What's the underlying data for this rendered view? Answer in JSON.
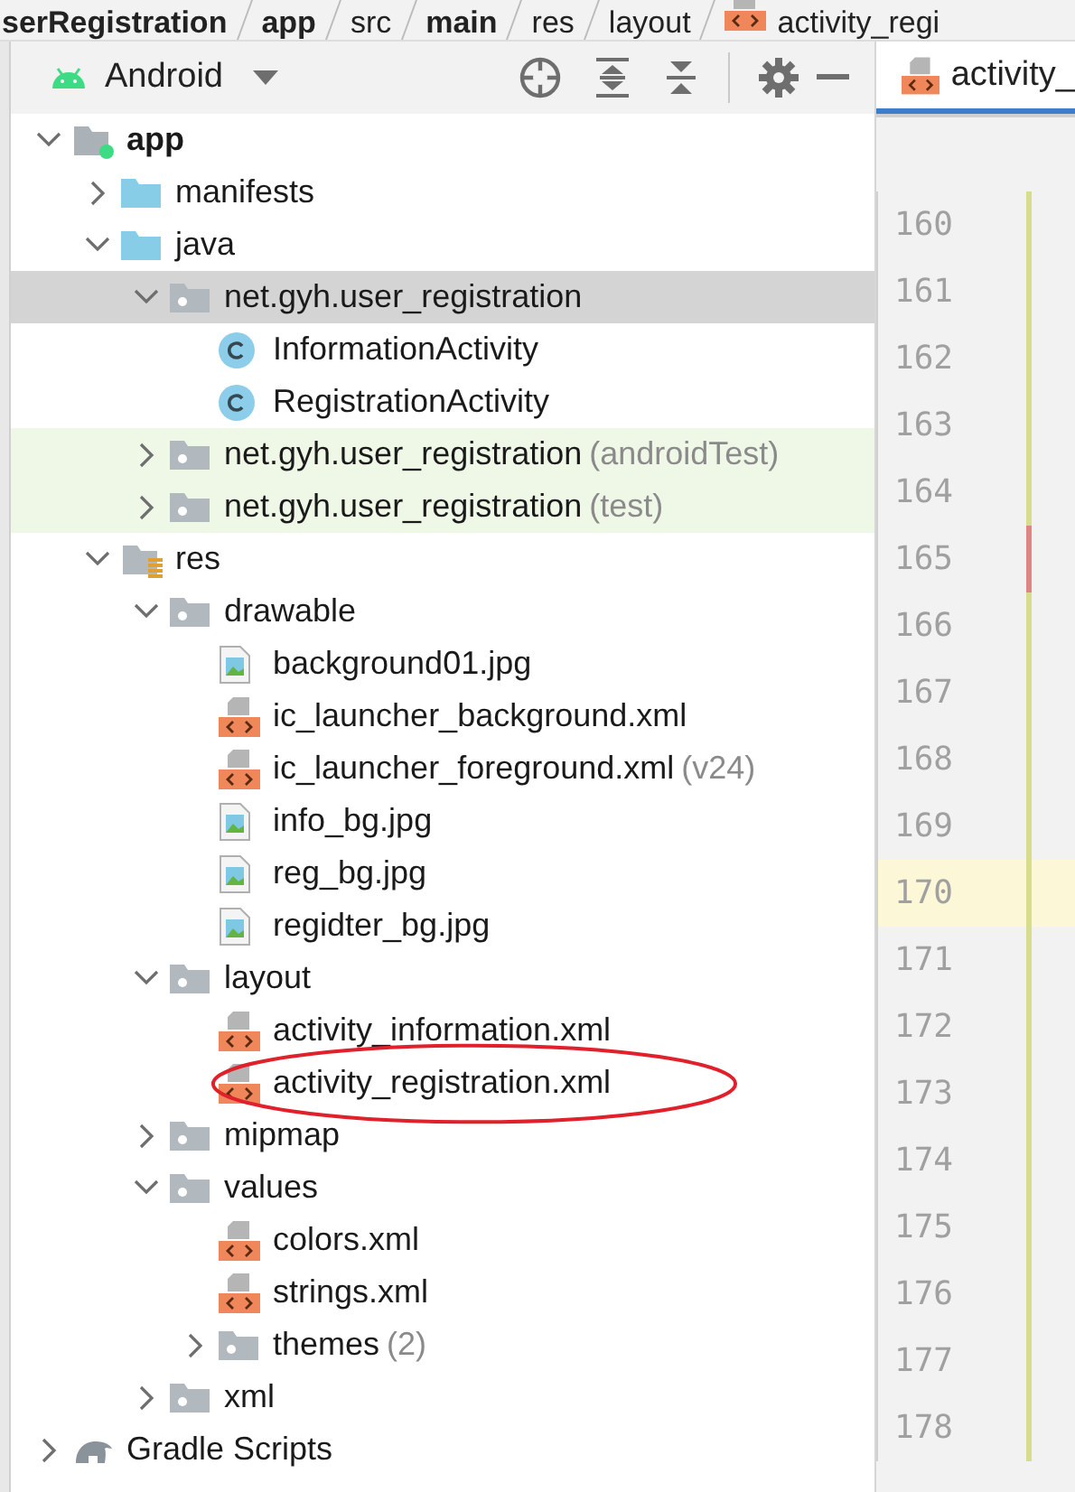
{
  "breadcrumb": [
    {
      "label": "serRegistration",
      "bold": true,
      "kind": "folder"
    },
    {
      "label": "app",
      "bold": true,
      "kind": "folder"
    },
    {
      "label": "src",
      "bold": false,
      "kind": "folder"
    },
    {
      "label": "main",
      "bold": true,
      "kind": "folder"
    },
    {
      "label": "res",
      "bold": false,
      "kind": "folder"
    },
    {
      "label": "layout",
      "bold": false,
      "kind": "folder"
    },
    {
      "label": "activity_regi",
      "bold": false,
      "kind": "xml"
    }
  ],
  "project_view": {
    "title": "Android"
  },
  "tree": [
    {
      "label": "app",
      "kind": "module",
      "expanded": true,
      "selected": false,
      "children": [
        {
          "label": "manifests",
          "kind": "folder",
          "expanded": false,
          "selected": false
        },
        {
          "label": "java",
          "kind": "folder",
          "expanded": true,
          "selected": false,
          "children": [
            {
              "label": "net.gyh.user_registration",
              "kind": "package",
              "expanded": true,
              "selected": true,
              "children": [
                {
                  "label": "InformationActivity",
                  "kind": "class",
                  "selected": false
                },
                {
                  "label": "RegistrationActivity",
                  "kind": "class",
                  "selected": false
                }
              ]
            },
            {
              "label": "net.gyh.user_registration",
              "suffix": "(androidTest)",
              "kind": "package",
              "expanded": false,
              "selected": false,
              "tinted": true
            },
            {
              "label": "net.gyh.user_registration",
              "suffix": "(test)",
              "kind": "package",
              "expanded": false,
              "selected": false,
              "tinted": true
            }
          ]
        },
        {
          "label": "res",
          "kind": "res",
          "expanded": true,
          "selected": false,
          "children": [
            {
              "label": "drawable",
              "kind": "package",
              "expanded": true,
              "selected": false,
              "children": [
                {
                  "label": "background01.jpg",
                  "kind": "image",
                  "selected": false
                },
                {
                  "label": "ic_launcher_background.xml",
                  "kind": "xml",
                  "selected": false
                },
                {
                  "label": "ic_launcher_foreground.xml",
                  "suffix": "(v24)",
                  "kind": "xml",
                  "selected": false
                },
                {
                  "label": "info_bg.jpg",
                  "kind": "image",
                  "selected": false
                },
                {
                  "label": "reg_bg.jpg",
                  "kind": "image",
                  "selected": false
                },
                {
                  "label": "regidter_bg.jpg",
                  "kind": "image",
                  "selected": false
                }
              ]
            },
            {
              "label": "layout",
              "kind": "package",
              "expanded": true,
              "selected": false,
              "children": [
                {
                  "label": "activity_information.xml",
                  "kind": "xml",
                  "selected": false
                },
                {
                  "label": "activity_registration.xml",
                  "kind": "xml",
                  "selected": false,
                  "circled": true
                }
              ]
            },
            {
              "label": "mipmap",
              "kind": "package",
              "expanded": false,
              "selected": false
            },
            {
              "label": "values",
              "kind": "package",
              "expanded": true,
              "selected": false,
              "children": [
                {
                  "label": "colors.xml",
                  "kind": "xml",
                  "selected": false
                },
                {
                  "label": "strings.xml",
                  "kind": "xml",
                  "selected": false
                },
                {
                  "label": "themes",
                  "suffix": "(2)",
                  "kind": "package",
                  "expanded": false,
                  "selected": false
                }
              ]
            },
            {
              "label": "xml",
              "kind": "package",
              "expanded": false,
              "selected": false
            }
          ]
        }
      ]
    },
    {
      "label": "Gradle Scripts",
      "kind": "gradle",
      "expanded": false,
      "selected": false
    }
  ],
  "editor": {
    "tab": {
      "label": "activity_",
      "selected": true
    },
    "lines": [
      {
        "number": "160",
        "current": false,
        "kind": "modified"
      },
      {
        "number": "161",
        "current": false,
        "kind": "modified"
      },
      {
        "number": "162",
        "current": false,
        "kind": "modified"
      },
      {
        "number": "163",
        "current": false,
        "kind": "modified"
      },
      {
        "number": "164",
        "current": false,
        "kind": "modified"
      },
      {
        "number": "165",
        "current": false,
        "kind": "deleted"
      },
      {
        "number": "166",
        "current": false,
        "kind": "modified"
      },
      {
        "number": "167",
        "current": false,
        "kind": "modified"
      },
      {
        "number": "168",
        "current": false,
        "kind": "modified"
      },
      {
        "number": "169",
        "current": false,
        "kind": "modified"
      },
      {
        "number": "170",
        "current": true,
        "kind": "modified"
      },
      {
        "number": "171",
        "current": false,
        "kind": "modified"
      },
      {
        "number": "172",
        "current": false,
        "kind": "modified"
      },
      {
        "number": "173",
        "current": false,
        "kind": "modified"
      },
      {
        "number": "174",
        "current": false,
        "kind": "modified"
      },
      {
        "number": "175",
        "current": false,
        "kind": "modified"
      },
      {
        "number": "176",
        "current": false,
        "kind": "modified"
      },
      {
        "number": "177",
        "current": false,
        "kind": "modified"
      },
      {
        "number": "178",
        "current": false,
        "kind": "modified"
      }
    ]
  }
}
